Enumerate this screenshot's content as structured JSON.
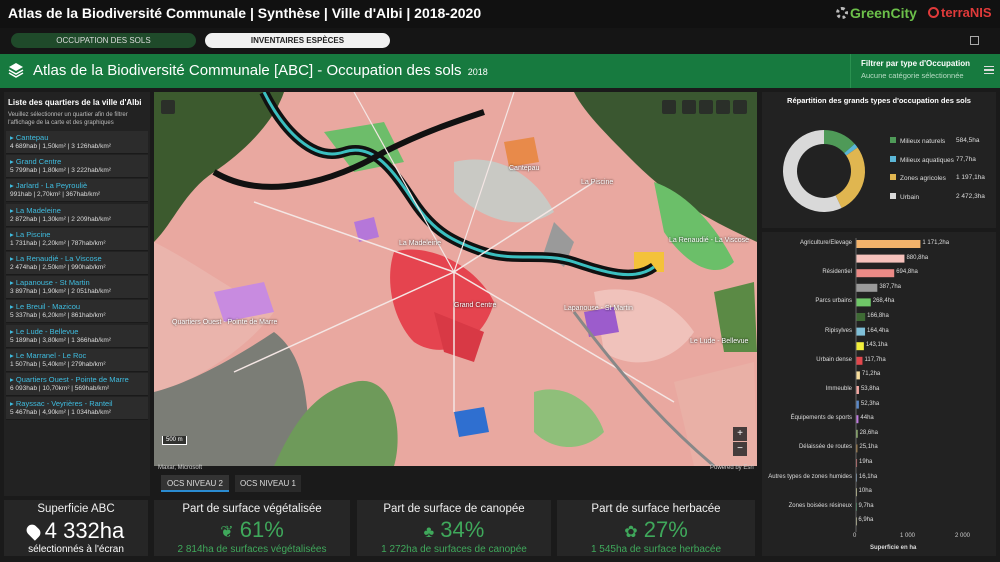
{
  "app": {
    "title": "Atlas de la Biodiversité Communale | Synthèse | Ville d'Albi | 2018-2020",
    "logo_greencity": "GreenCity",
    "logo_terranis": "terraNIS"
  },
  "tabs": [
    {
      "label": "OCCUPATION DES SOLS"
    },
    {
      "label": "INVENTAIRES ESPÈCES"
    }
  ],
  "header": {
    "title": "Atlas de la Biodiversité Communale [ABC] - Occupation des sols",
    "year": "2018",
    "filter_label": "Filtrer par type d'Occupation ...",
    "filter_sub": "Aucune catégorie sélectionnée"
  },
  "left_panel": {
    "title": "Liste des quartiers de la ville d'Albi",
    "desc": "Veuillez sélectionner un quartier afin de filtrer l'affichage de la carte et des graphiques",
    "items": [
      {
        "name": "Cantepau",
        "stats": "4 689hab | 1,50km² | 3 126hab/km²"
      },
      {
        "name": "Grand Centre",
        "stats": "5 799hab | 1,80km² | 3 222hab/km²"
      },
      {
        "name": "Jarlard - La Peyrouliè",
        "stats": "991hab | 2,70km² | 367hab/km²"
      },
      {
        "name": "La Madeleine",
        "stats": "2 872hab | 1,30km² | 2 209hab/km²"
      },
      {
        "name": "La Piscine",
        "stats": "1 731hab | 2,20km² | 787hab/km²"
      },
      {
        "name": "La Renaudié - La Viscose",
        "stats": "2 474hab | 2,50km² | 990hab/km²"
      },
      {
        "name": "Lapanouse - St Martin",
        "stats": "3 897hab | 1,90km² | 2 051hab/km²"
      },
      {
        "name": "Le Breuil - Mazicou",
        "stats": "5 337hab | 6,20km² | 861hab/km²"
      },
      {
        "name": "Le Lude - Bellevue",
        "stats": "5 189hab | 3,80km² | 1 366hab/km²"
      },
      {
        "name": "Le Marranel - Le Roc",
        "stats": "1 507hab | 5,40km² | 279hab/km²"
      },
      {
        "name": "Quartiers Ouest - Pointe de Marre",
        "stats": "6 093hab | 10,70km² | 569hab/km²"
      },
      {
        "name": "Rayssac - Veyrières - Ranteil",
        "stats": "5 467hab | 4,90km² | 1 034hab/km²"
      }
    ]
  },
  "map": {
    "attribution_left": "Maxar, Microsoft",
    "attribution_right": "Powered by Esri",
    "scale": "500 m",
    "zoom_in": "+",
    "zoom_out": "−",
    "labels": [
      "Cantepau",
      "La Piscine",
      "La Madeleine",
      "La Renaudié - La Viscose",
      "Grand Centre",
      "Quartiers Ouest - Pointe de Marre",
      "Lapanouse - St Martin",
      "Le Lude - Bellevue"
    ]
  },
  "ocs_tabs": [
    {
      "label": "OCS NIVEAU 2"
    },
    {
      "label": "OCS NIVEAU 1"
    }
  ],
  "kpis": {
    "superficie": {
      "title": "Superficie ABC",
      "value": "4 332ha",
      "sub": "sélectionnés à l'écran"
    },
    "vegetalisee": {
      "title": "Part de surface végétalisée",
      "value": "61%",
      "sub": "2 814ha de surfaces végétalisées"
    },
    "canopee": {
      "title": "Part de surface de canopée",
      "value": "34%",
      "sub": "1 272ha de surfaces de canopée"
    },
    "herbacee": {
      "title": "Part de surface herbacée",
      "value": "27%",
      "sub": "1 545ha de surface herbacée"
    }
  },
  "donut": {
    "title": "Répartition des grands types d'occupation des sols",
    "items": [
      {
        "label": "Milieux naturels",
        "value": "584,5ha",
        "color": "#4f9a58"
      },
      {
        "label": "Milieux aquatiques",
        "value": "77,7ha",
        "color": "#5bb6d6"
      },
      {
        "label": "Zones agricoles",
        "value": "1 197,1ha",
        "color": "#e0b650"
      },
      {
        "label": "Urbain",
        "value": "2 472,3ha",
        "color": "#d9d9d9"
      }
    ]
  },
  "chart_data": {
    "type": "bar",
    "orientation": "horizontal",
    "title": "",
    "xlabel": "Superficie en ha",
    "ylabel": "",
    "xlim": [
      0,
      2000
    ],
    "xticks": [
      "0",
      "1 000",
      "2 000"
    ],
    "categories": [
      "Agriculture/Elevage",
      "",
      "Résidentiel",
      "",
      "Parcs urbains",
      "",
      "Ripisylves",
      "",
      "Urbain dense",
      "",
      "Immeuble",
      "",
      "Équipements de sports",
      "",
      "Délaissée de routes",
      "",
      "Autres types de zones humides",
      "",
      "Zones boisées résineux",
      ""
    ],
    "values": [
      1171.2,
      880.8,
      694.8,
      387.7,
      268.4,
      166.8,
      164.4,
      143.1,
      117.7,
      71.2,
      53.8,
      52.3,
      44,
      28.6,
      25.1,
      19,
      16.1,
      10,
      9.7,
      6.9
    ],
    "value_labels": [
      "1 171,2ha",
      "880,8ha",
      "694,8ha",
      "387,7ha",
      "268,4ha",
      "166,8ha",
      "164,4ha",
      "143,1ha",
      "117,7ha",
      "71,2ha",
      "53,8ha",
      "52,3ha",
      "44ha",
      "28,6ha",
      "25,1ha",
      "19ha",
      "16,1ha",
      "10ha",
      "9,7ha",
      "6,9ha"
    ],
    "colors": [
      "#f3b36b",
      "#f6c1bb",
      "#ec8a86",
      "#9a9a9a",
      "#6fc768",
      "#3e6a34",
      "#7fbfd8",
      "#f1ee3a",
      "#e2474c",
      "#f6dc9c",
      "#f3a6a0",
      "#5a88c8",
      "#c07ae0",
      "#a7d17d",
      "#b88a4a",
      "#e06f6f",
      "#7ea0c0",
      "#e0e0a0",
      "#3a8a5a",
      "#d0d0a0"
    ]
  }
}
